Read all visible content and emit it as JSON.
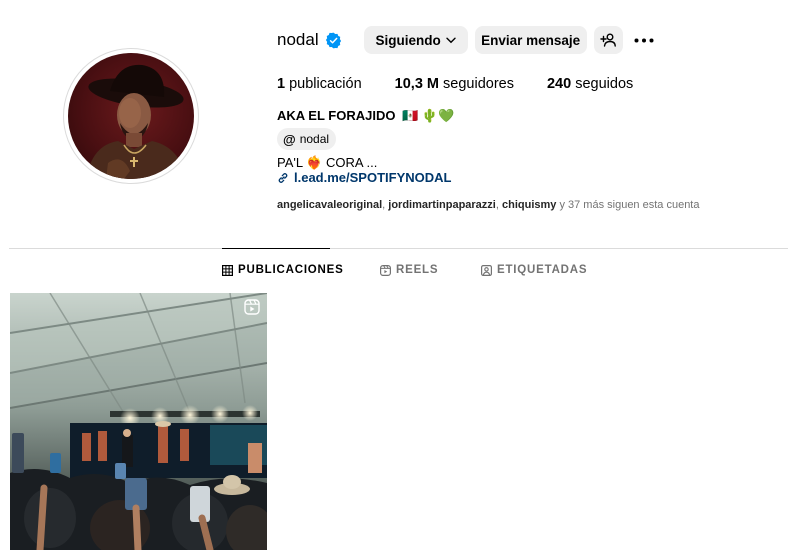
{
  "profile": {
    "username": "nodal",
    "buttons": {
      "following": "Siguiendo",
      "message": "Enviar mensaje"
    },
    "stats": {
      "posts_count": "1",
      "posts_label": "publicación",
      "followers_count": "10,3 M",
      "followers_label": "seguidores",
      "following_count": "240",
      "following_label": "seguidos"
    },
    "full_name": "AKA EL FORAJIDO",
    "full_name_emojis": "🇲🇽 🌵💚",
    "threads_handle": "nodal",
    "bio": "PA'L ❤️‍🔥 CORA ...",
    "link": "l.ead.me/SPOTIFYNODAL",
    "followed_by": {
      "users": [
        "angelicavaleoriginal",
        "jordimartinpaparazzi",
        "chiquismy"
      ],
      "rest": "y 37 más siguen esta cuenta"
    }
  },
  "tabs": [
    {
      "label": "PUBLICACIONES",
      "icon": "grid-icon",
      "active": true
    },
    {
      "label": "REELS",
      "icon": "reels-icon",
      "active": false
    },
    {
      "label": "ETIQUETADAS",
      "icon": "tagged-icon",
      "active": false
    }
  ],
  "colors": {
    "verified": "#0095f6",
    "link": "#00376b",
    "button_bg": "#efefef",
    "muted_text": "#737373"
  }
}
